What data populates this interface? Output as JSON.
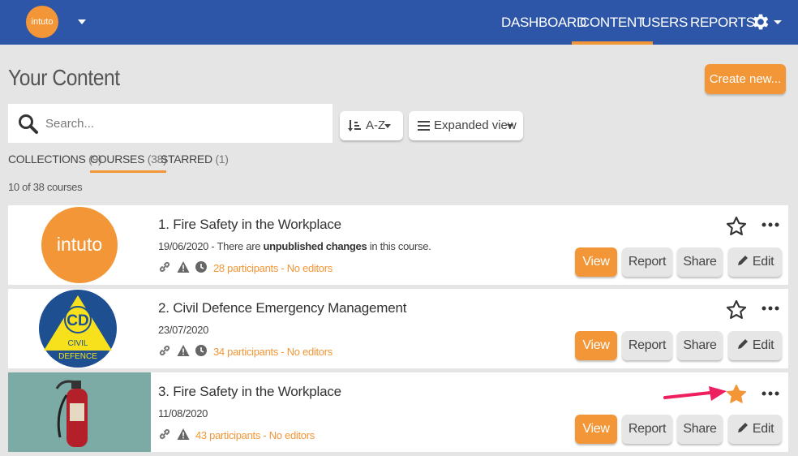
{
  "header": {
    "logo_text": "intuto",
    "nav": [
      "DASHBOARD",
      "CONTENT",
      "USERS",
      "REPORTS"
    ],
    "active_nav": "CONTENT"
  },
  "page": {
    "title": "Your Content",
    "create_label": "Create new..."
  },
  "search": {
    "placeholder": "Search..."
  },
  "controls": {
    "sort_label": "A-Z",
    "view_label": "Expanded view"
  },
  "tabs": [
    {
      "label": "COLLECTIONS",
      "count": "(9)"
    },
    {
      "label": "COURSES",
      "count": "(38)"
    },
    {
      "label": "STARRED",
      "count": "(1)"
    }
  ],
  "result_count": "10 of 38 courses",
  "courses": [
    {
      "title": "1. Fire Safety in the Workplace",
      "date": "19/06/2020",
      "note_prefix": " - There are ",
      "note_bold": "unpublished changes",
      "note_suffix": " in this course.",
      "participants": "28 participants - No editors",
      "starred": false,
      "thumb": "intuto-logo"
    },
    {
      "title": "2. Civil Defence Emergency Management",
      "date": "23/07/2020",
      "note_prefix": "",
      "note_bold": "",
      "note_suffix": "",
      "participants": "34 participants - No editors",
      "starred": false,
      "thumb": "civil-defence-logo"
    },
    {
      "title": "3. Fire Safety in the Workplace",
      "date": "11/08/2020",
      "note_prefix": "",
      "note_bold": "",
      "note_suffix": "",
      "participants": "43 participants - No editors",
      "starred": true,
      "thumb": "fire-extinguisher-photo"
    }
  ],
  "actions": {
    "view": "View",
    "report": "Report",
    "share": "Share",
    "edit": "Edit"
  },
  "thumb_text": {
    "intuto": "intuto",
    "cd": "CD",
    "civil": "CIVIL",
    "defence": "DEFENCE"
  },
  "colors": {
    "header": "#2d56a8",
    "accent": "#f39637",
    "annotation_arrow": "#ee1f5f"
  }
}
